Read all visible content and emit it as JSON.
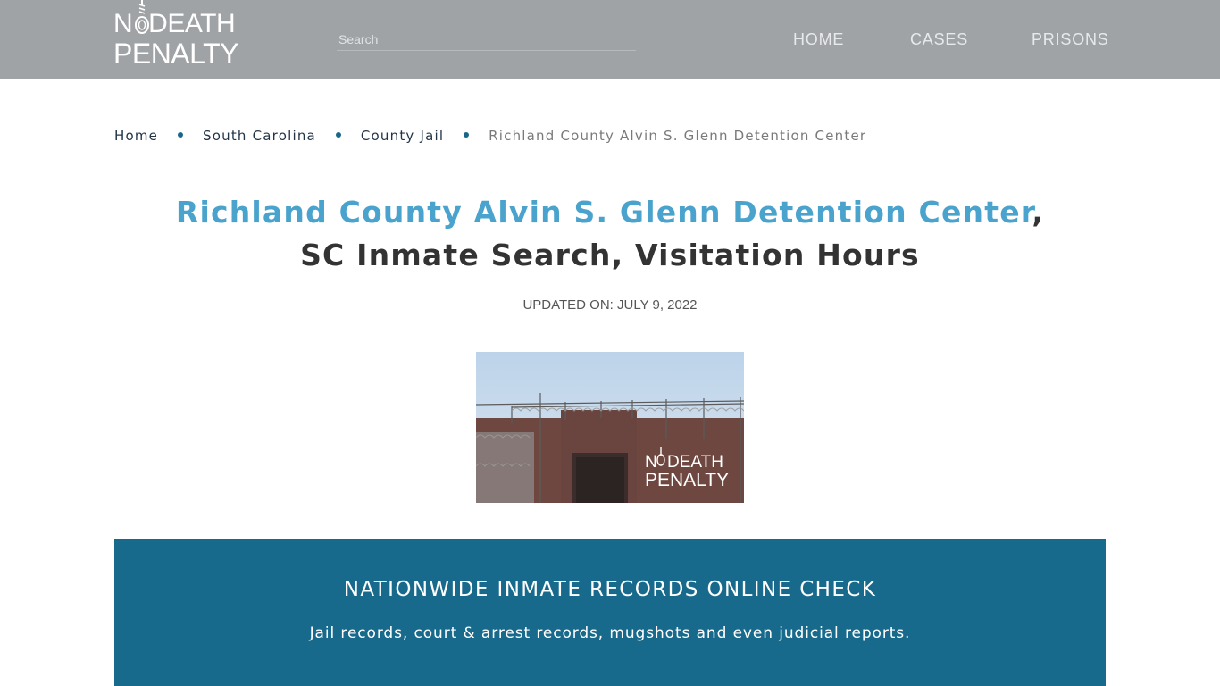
{
  "header": {
    "logo": {
      "line1_prefix": "N",
      "line1_rest": "DEATH",
      "line2": "PENALTY"
    },
    "search": {
      "placeholder": "Search",
      "value": ""
    },
    "nav": [
      {
        "label": "HOME"
      },
      {
        "label": "CASES"
      },
      {
        "label": "PRISONS"
      }
    ]
  },
  "breadcrumb": {
    "items": [
      {
        "label": "Home"
      },
      {
        "label": "South Carolina"
      },
      {
        "label": "County Jail"
      }
    ],
    "current": "Richland County Alvin S. Glenn Detention Center"
  },
  "page": {
    "title_accent": "Richland County Alvin S. Glenn Detention Center",
    "title_rest": ", SC Inmate Search, Visitation Hours",
    "updated": "UPDATED ON: JULY 9, 2022",
    "hero_image": {
      "alt": "Richland County Alvin S. Glenn Detention Center building with razor-wire fence",
      "watermark_line1_prefix": "N",
      "watermark_line1_rest": "DEATH",
      "watermark_line2": "PENALTY"
    }
  },
  "banner": {
    "title": "NATIONWIDE INMATE RECORDS ONLINE CHECK",
    "subtitle": "Jail records, court & arrest records, mugshots and even judicial reports."
  },
  "colors": {
    "header_bg": "#9fa3a6",
    "accent": "#4aa3cd",
    "banner_bg": "#176a8c",
    "breadcrumb_dot": "#17678a"
  }
}
